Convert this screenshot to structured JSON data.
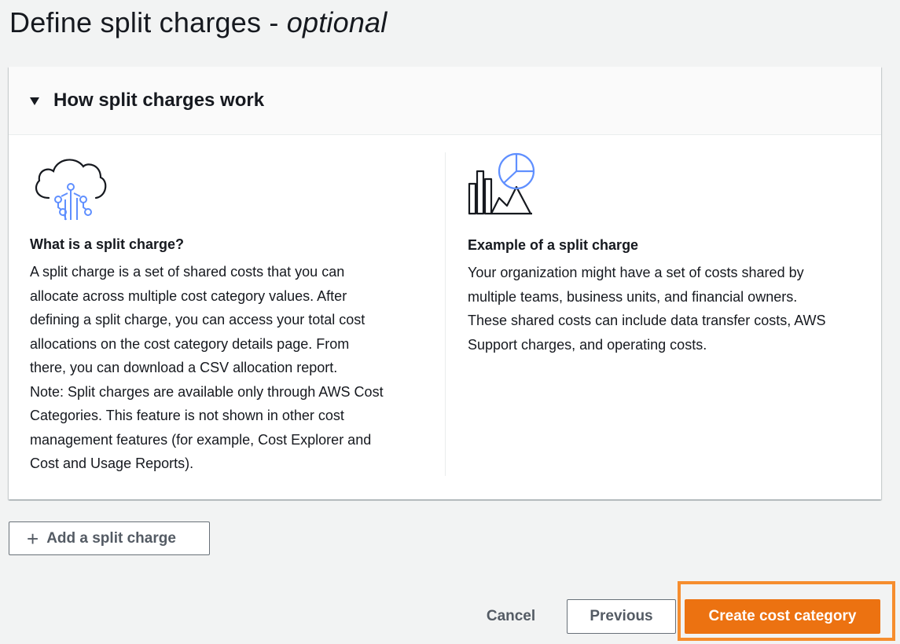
{
  "page": {
    "title_main": "Define split charges -",
    "title_optional": "optional"
  },
  "panel": {
    "header_title": "How split charges work",
    "left": {
      "icon": "cloud-network-icon",
      "heading": "What is a split charge?",
      "lines": [
        "A split charge is a set of shared costs that you can",
        "allocate across multiple cost category values. After",
        "defining a split charge, you can access your total cost",
        "allocations on the cost category details page. From",
        "there, you can download a CSV allocation report.",
        "Note: Split charges are available only through AWS Cost",
        "Categories. This feature is not shown in other cost",
        "management features (for example, Cost Explorer and",
        "Cost and Usage Reports)."
      ]
    },
    "right": {
      "icon": "charts-analytics-icon",
      "heading": "Example of a split charge",
      "lines": [
        "Your organization might have a set of costs shared by",
        "multiple teams, business units, and financial owners.",
        "These shared costs can include data transfer costs, AWS",
        "Support charges, and operating costs."
      ]
    }
  },
  "actions": {
    "add_split_label": "Add a split charge",
    "add_split_icon": "plus-icon",
    "cancel_label": "Cancel",
    "previous_label": "Previous",
    "create_label": "Create cost category"
  },
  "colors": {
    "primary": "#ec7211",
    "highlight": "#f68d2e",
    "icon_blue": "#5f8fff",
    "text": "#16191f",
    "muted": "#545b64"
  }
}
